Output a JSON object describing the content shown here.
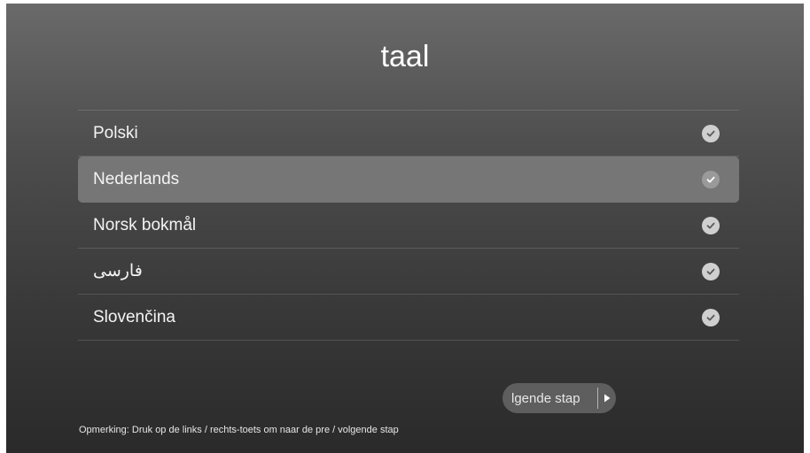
{
  "title": "taal",
  "languages": [
    {
      "label": "Polski",
      "selected": false
    },
    {
      "label": "Nederlands",
      "selected": true
    },
    {
      "label": "Norsk bokmål",
      "selected": false
    },
    {
      "label": "فارسی",
      "selected": false
    },
    {
      "label": "Slovenčina",
      "selected": false
    }
  ],
  "next_button": {
    "label": "lgende stap"
  },
  "note": "Opmerking: Druk op de links / rechts-toets om naar de pre / volgende stap",
  "colors": {
    "selected_row": "#767676",
    "check": "#cfcfcf",
    "text": "#f4f4f4"
  },
  "icons": {
    "check": "checkmark-circle-icon",
    "next": "play-arrow-icon"
  }
}
